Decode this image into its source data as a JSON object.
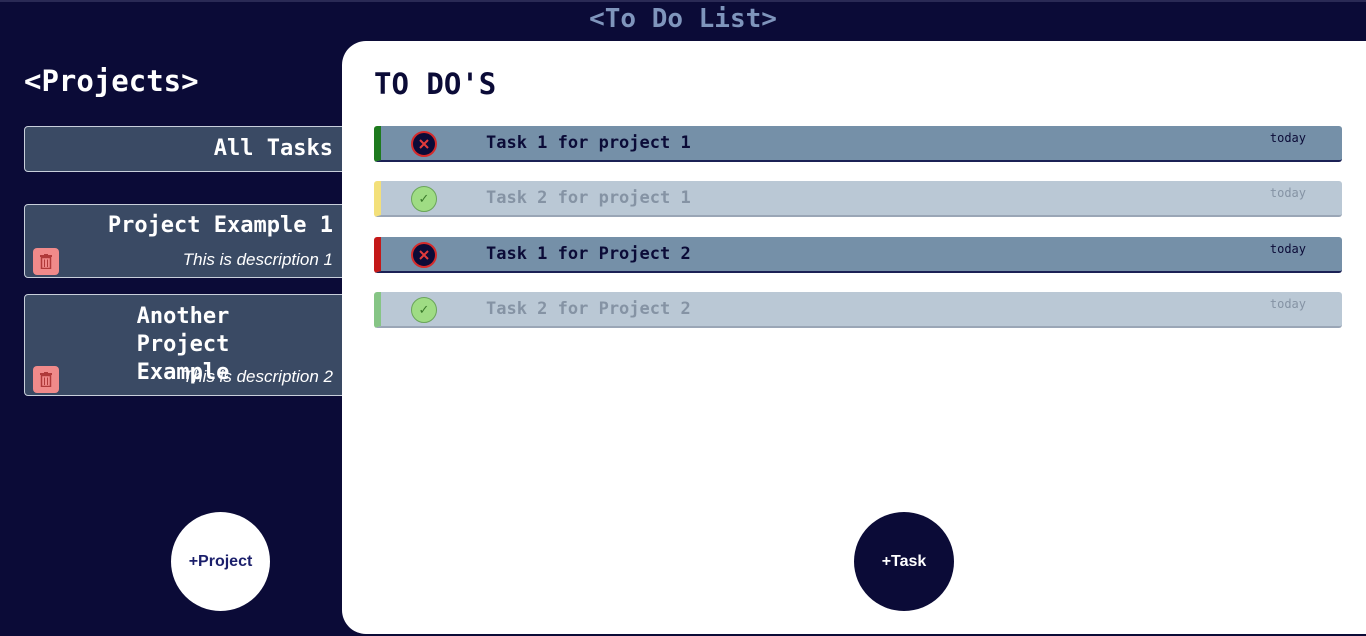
{
  "app": {
    "title": "<To Do List>"
  },
  "sidebar": {
    "title": "<Projects>",
    "all_tasks_label": "All Tasks",
    "projects": [
      {
        "name": "Project Example 1",
        "description": "This is description 1",
        "delete_icon": "trash-icon"
      },
      {
        "name": "Another Project Example",
        "description": "This is description 2",
        "delete_icon": "trash-icon"
      }
    ],
    "add_project_label": "+Project"
  },
  "main": {
    "title": "TO DO'S",
    "tasks": [
      {
        "name": "Task 1 for project 1",
        "date": "today",
        "completed": false,
        "priority_color": "#1e7a1e",
        "status_icon": "close-circle-icon"
      },
      {
        "name": "Task 2 for project 1",
        "date": "today",
        "completed": true,
        "priority_color": "#f3e07a",
        "status_icon": "check-circle-icon"
      },
      {
        "name": "Task 1 for Project 2",
        "date": "today",
        "completed": false,
        "priority_color": "#c41818",
        "status_icon": "close-circle-icon"
      },
      {
        "name": "Task 2 for Project 2",
        "date": "today",
        "completed": true,
        "priority_color": "#86c585",
        "status_icon": "check-circle-icon"
      }
    ],
    "add_task_label": "+Task"
  },
  "colors": {
    "background": "#0b0b37",
    "card": "#3a4a64",
    "task_pending": "#7590a8",
    "task_done": "#bac8d5",
    "delete": "#f08a8a"
  }
}
